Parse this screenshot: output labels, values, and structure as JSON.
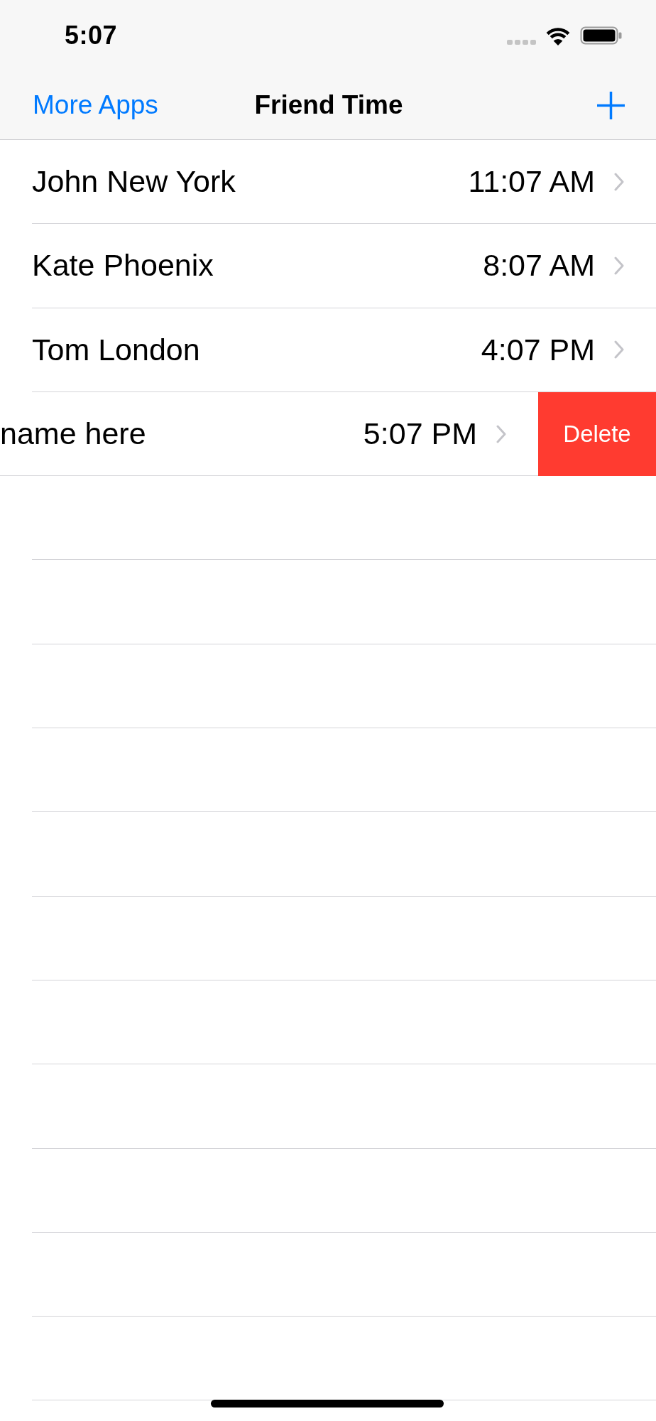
{
  "status_bar": {
    "time": "5:07"
  },
  "nav_bar": {
    "left_button": "More Apps",
    "title": "Friend Time"
  },
  "friends": [
    {
      "name": "John New York",
      "time": "11:07 AM",
      "swiped": false
    },
    {
      "name": "Kate Phoenix",
      "time": "8:07 AM",
      "swiped": false
    },
    {
      "name": "Tom London",
      "time": "4:07 PM",
      "swiped": false
    },
    {
      "name": "name here",
      "time": "5:07 PM",
      "swiped": true,
      "delete_label": "Delete"
    }
  ]
}
